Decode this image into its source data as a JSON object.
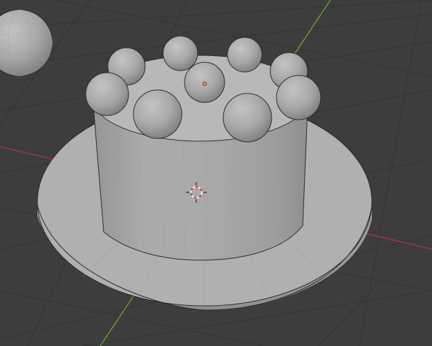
{
  "viewport": {
    "view": "3d-viewport",
    "shading": "solid",
    "colors": {
      "background": "#3d3d3d",
      "grid_line": "#333333",
      "x_axis": "#9a3a43",
      "y_axis": "#6e9b2e",
      "mesh_light": "#b5b5b5",
      "mesh_mid": "#a2a2a2",
      "mesh_dark": "#7d7d7d",
      "origin_dot": "#ff8a1e",
      "cursor_red": "#d63b3b",
      "cursor_white": "#f2f2f2"
    }
  },
  "scene": {
    "objects": [
      {
        "name": "brim",
        "type": "cylinder"
      },
      {
        "name": "crown",
        "type": "cylinder"
      },
      {
        "name": "background-sphere",
        "type": "uv-sphere"
      },
      {
        "name": "top-spheres",
        "type": "uv-sphere",
        "count": 9
      }
    ],
    "icons": {
      "cursor": "3d-cursor-icon",
      "origin": "object-origin-icon"
    }
  }
}
